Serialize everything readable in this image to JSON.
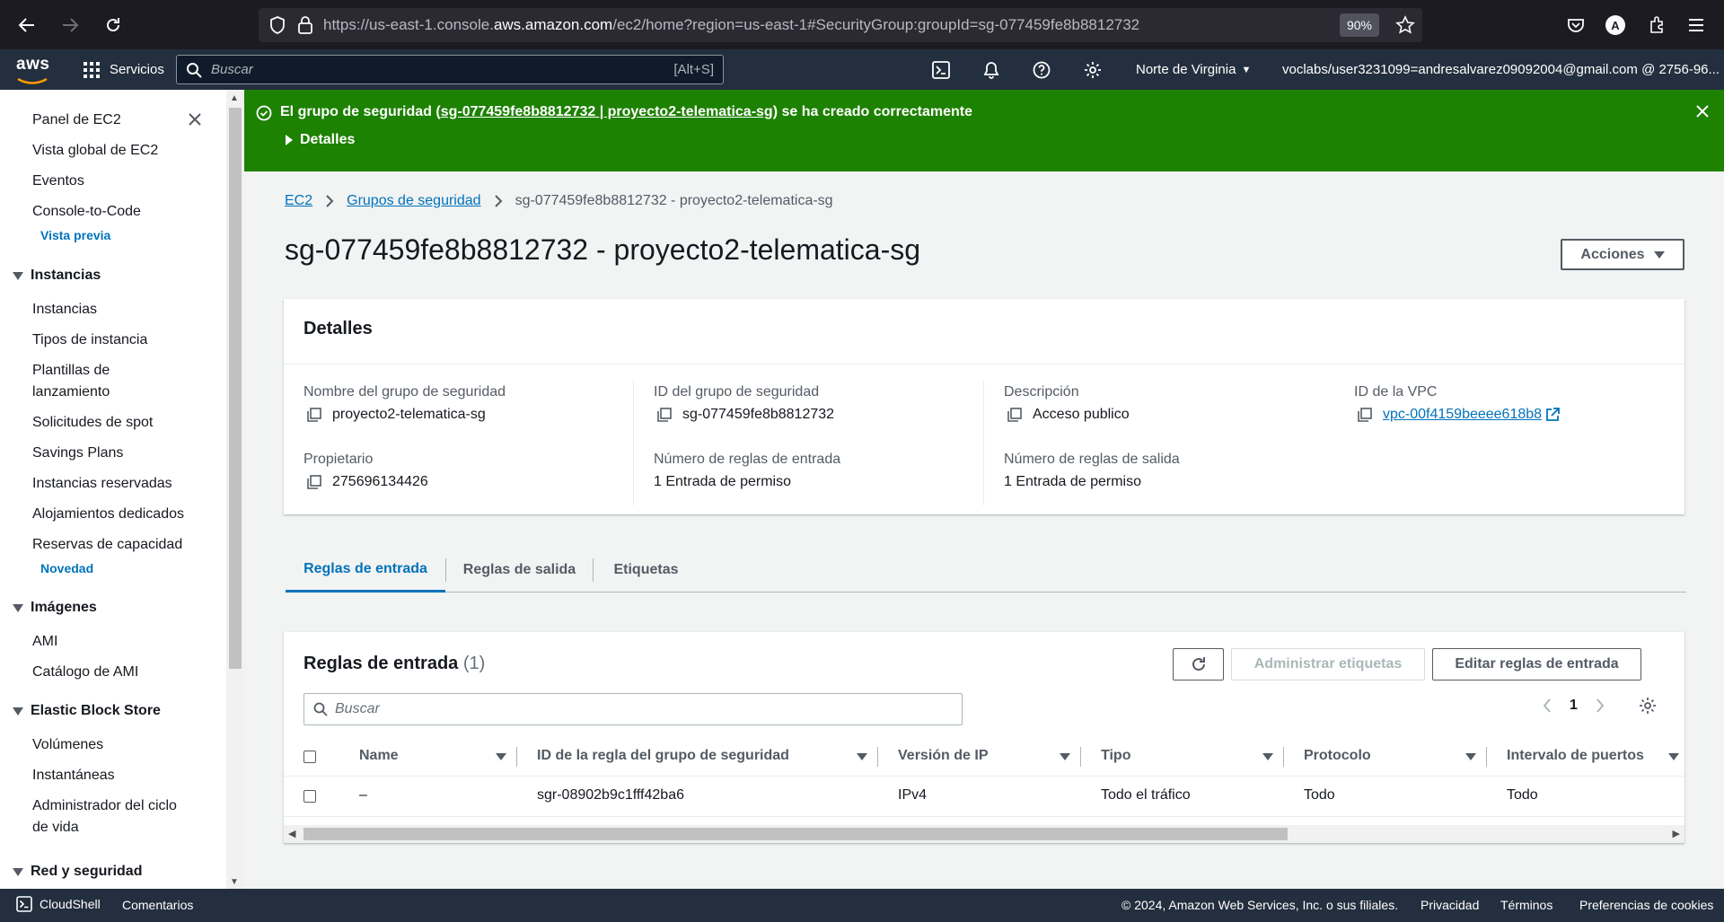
{
  "browser": {
    "url_prefix": "https://us-east-1.console.",
    "url_domain": "aws.amazon.com",
    "url_suffix": "/ec2/home?region=us-east-1#SecurityGroup:groupId=sg-077459fe8b8812732",
    "zoom": "90%",
    "profile_initial": "A"
  },
  "topnav": {
    "logo": "aws",
    "services_label": "Servicios",
    "search_placeholder": "Buscar",
    "search_shortcut": "[Alt+S]",
    "region": "Norte de Virginia",
    "account": "voclabs/user3231099=andresalvarez09092004@gmail.com @ 2756-96..."
  },
  "sidebar": {
    "panel": "Panel de EC2",
    "global_view": "Vista global de EC2",
    "events": "Eventos",
    "console_to_code": "Console-to-Code",
    "preview_badge": "Vista previa",
    "sec_instances": "Instancias",
    "instances": "Instancias",
    "instance_types": "Tipos de instancia",
    "launch_templates_1": "Plantillas de",
    "launch_templates_2": "lanzamiento",
    "spot_requests": "Solicitudes de spot",
    "savings_plans": "Savings Plans",
    "reserved_instances": "Instancias reservadas",
    "dedicated_hosts": "Alojamientos dedicados",
    "capacity_reservations": "Reservas de capacidad",
    "new_badge": "Novedad",
    "sec_images": "Imágenes",
    "ami": "AMI",
    "ami_catalog": "Catálogo de AMI",
    "sec_ebs": "Elastic Block Store",
    "volumes": "Volúmenes",
    "snapshots": "Instantáneas",
    "lifecycle_manager_1": "Administrador del ciclo",
    "lifecycle_manager_2": "de vida",
    "sec_network": "Red y seguridad"
  },
  "flash": {
    "msg_prefix": "El grupo de seguridad (",
    "msg_link": "sg-077459fe8b8812732 | proyecto2-telematica-sg",
    "msg_suffix": ") se ha creado correctamente",
    "details": "Detalles"
  },
  "breadcrumb": {
    "ec2": "EC2",
    "groups": "Grupos de seguridad",
    "current": "sg-077459fe8b8812732 - proyecto2-telematica-sg"
  },
  "title": "sg-077459fe8b8812732 - proyecto2-telematica-sg",
  "actions_label": "Acciones",
  "details": {
    "heading": "Detalles",
    "name_label": "Nombre del grupo de seguridad",
    "name_value": "proyecto2-telematica-sg",
    "id_label": "ID del grupo de seguridad",
    "id_value": "sg-077459fe8b8812732",
    "desc_label": "Descripción",
    "desc_value": "Acceso publico",
    "vpc_label": "ID de la VPC",
    "vpc_value": "vpc-00f4159beeee618b8",
    "owner_label": "Propietario",
    "owner_value": "275696134426",
    "inbound_label": "Número de reglas de entrada",
    "inbound_value": "1 Entrada de permiso",
    "outbound_label": "Número de reglas de salida",
    "outbound_value": "1 Entrada de permiso"
  },
  "tabs": {
    "inbound": "Reglas de entrada",
    "outbound": "Reglas de salida",
    "tags": "Etiquetas"
  },
  "rules": {
    "title": "Reglas de entrada",
    "count": "(1)",
    "manage_tags": "Administrar etiquetas",
    "edit_rules": "Editar reglas de entrada",
    "search_placeholder": "Buscar",
    "page": "1",
    "columns": [
      "Name",
      "ID de la regla del grupo de seguridad",
      "Versión de IP",
      "Tipo",
      "Protocolo",
      "Intervalo de puertos"
    ],
    "row": [
      "–",
      "sgr-08902b9c1fff42ba6",
      "IPv4",
      "Todo el tráfico",
      "Todo",
      "Todo"
    ]
  },
  "footer": {
    "cloudshell": "CloudShell",
    "comments": "Comentarios",
    "copyright": "© 2024, Amazon Web Services, Inc. o sus filiales.",
    "privacy": "Privacidad",
    "terms": "Términos",
    "cookies": "Preferencias de cookies"
  },
  "colors": {
    "success": "#1d8102",
    "link": "#0073bb",
    "nav_bg": "#232f3e"
  }
}
